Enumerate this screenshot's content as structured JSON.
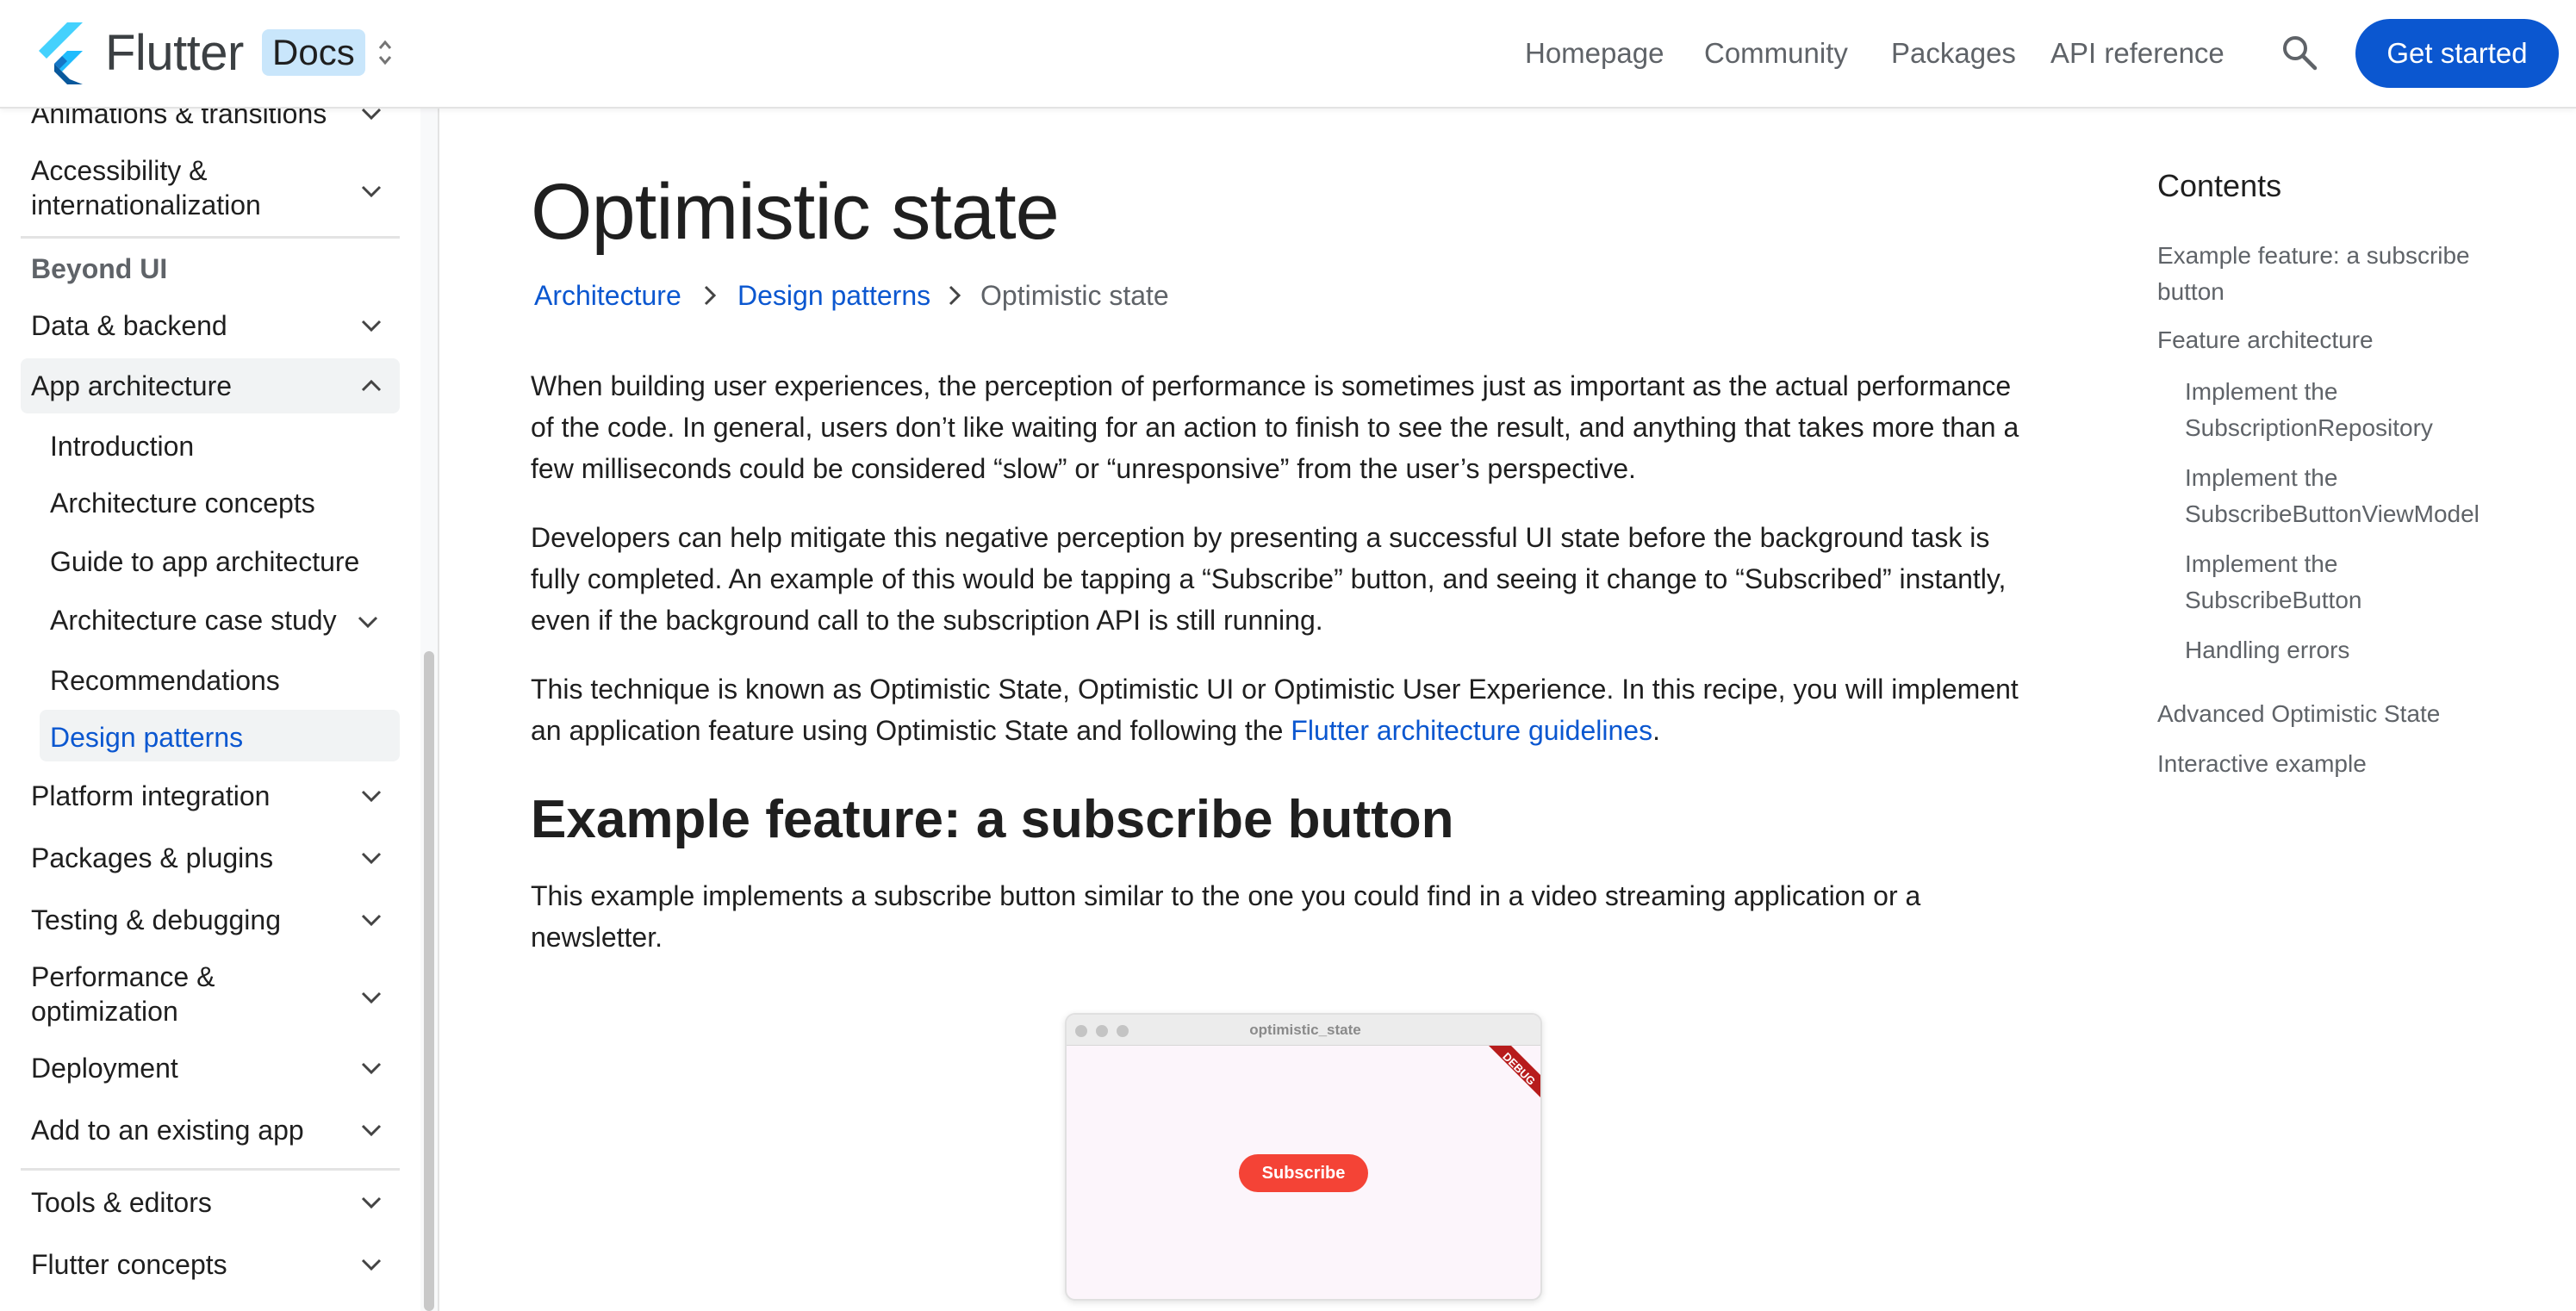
{
  "header": {
    "brand": "Flutter",
    "badge": "Docs",
    "nav": [
      "Homepage",
      "Community",
      "Packages",
      "API reference"
    ],
    "cta": "Get started",
    "colors": {
      "accent": "#0b57d0",
      "badge_bg": "#c9e6fb"
    }
  },
  "sidebar": {
    "items_top": [
      {
        "label": "Animations & transitions"
      },
      {
        "label_line1": "Accessibility &",
        "label_line2": "internationalization"
      }
    ],
    "section_heading": "Beyond UI",
    "data_backend": "Data & backend",
    "app_architecture": "App architecture",
    "sub_items": [
      "Introduction",
      "Architecture concepts",
      "Guide to app architecture",
      "Architecture case study",
      "Recommendations",
      "Design patterns"
    ],
    "items_bottom": [
      "Platform integration",
      "Packages & plugins",
      "Testing & debugging"
    ],
    "performance_line1": "Performance &",
    "performance_line2": "optimization",
    "deployment": "Deployment",
    "add_existing": "Add to an existing app",
    "tools": "Tools & editors",
    "concepts": "Flutter concepts"
  },
  "main": {
    "title": "Optimistic state",
    "breadcrumb": [
      "Architecture",
      "Design patterns",
      "Optimistic state"
    ],
    "p1_l1": "When building user experiences, the perception of performance is sometimes just as important as the actual performance",
    "p1_l2": "of the code. In general, users don’t like waiting for an action to finish to see the result, and anything that takes more than a",
    "p1_l3": "few milliseconds could be considered “slow” or “unresponsive” from the user’s perspective.",
    "p2_l1": "Developers can help mitigate this negative perception by presenting a successful UI state before the background task is",
    "p2_l2": "fully completed. An example of this would be tapping a “Subscribe” button, and seeing it change to “Subscribed” instantly,",
    "p2_l3": "even if the background call to the subscription API is still running.",
    "p3_l1": "This technique is known as Optimistic State, Optimistic UI or Optimistic User Experience. In this recipe, you will implement",
    "p3_l2_pre": "an application feature using Optimistic State and following the ",
    "p3_link": "Flutter architecture guidelines",
    "p3_l2_post": ".",
    "h2": "Example feature: a subscribe button",
    "p4_l1": "This example implements a subscribe button similar to the one you could find in a video streaming application or a",
    "p4_l2": "newsletter.",
    "demo": {
      "window_title": "optimistic_state",
      "ribbon": "DEBUG",
      "button": "Subscribe"
    }
  },
  "toc": {
    "title": "Contents",
    "i1_l1": "Example feature: a subscribe",
    "i1_l2": "button",
    "i2": "Feature architecture",
    "i3_l1": "Implement the",
    "i3_l2": "SubscriptionRepository",
    "i4_l1": "Implement the",
    "i4_l2": "SubscribeButtonViewModel",
    "i5_l1": "Implement the",
    "i5_l2": "SubscribeButton",
    "i6": "Handling errors",
    "i7": "Advanced Optimistic State",
    "i8": "Interactive example"
  }
}
